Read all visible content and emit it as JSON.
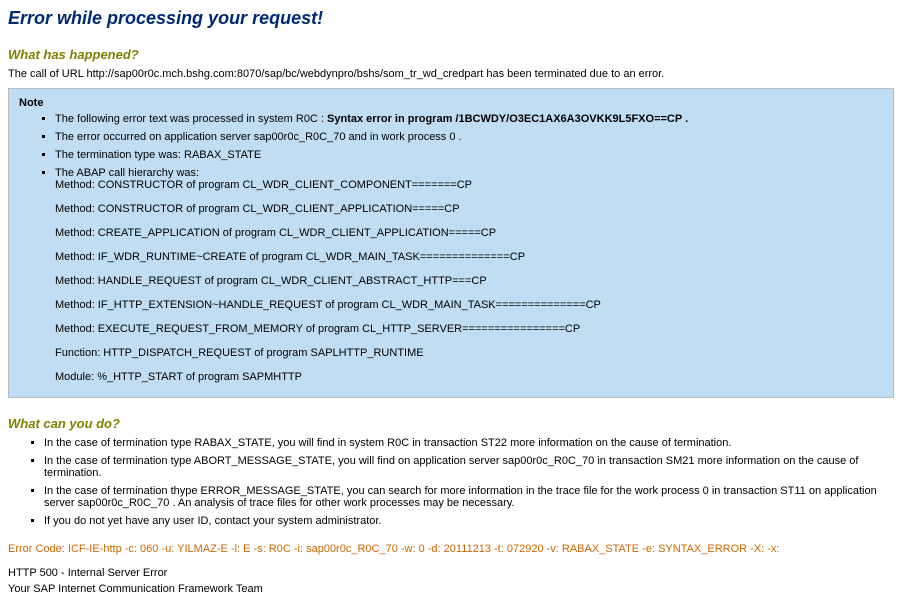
{
  "title": "Error while processing your request!",
  "section1": {
    "heading": "What has happened?",
    "text": "The call of URL http://sap00r0c.mch.bshg.com:8070/sap/bc/webdynpro/bshs/som_tr_wd_credpart has been terminated due to an error."
  },
  "note": {
    "title": "Note",
    "items": [
      {
        "prefix": "The following error text was processed in system R0C : ",
        "bold": "Syntax error in program /1BCWDY/O3EC1AX6A3OVKK9L5FXO==CP ."
      },
      {
        "text": "The error occurred on application server sap00r0c_R0C_70 and in work process 0 ."
      },
      {
        "text": "The termination type was: RABAX_STATE"
      },
      {
        "text": "The ABAP call hierarchy was:",
        "hierarchy": [
          "Method: CONSTRUCTOR of program CL_WDR_CLIENT_COMPONENT=======CP",
          "Method: CONSTRUCTOR of program CL_WDR_CLIENT_APPLICATION=====CP",
          "Method: CREATE_APPLICATION of program CL_WDR_CLIENT_APPLICATION=====CP",
          "Method: IF_WDR_RUNTIME~CREATE of program CL_WDR_MAIN_TASK==============CP",
          "Method: HANDLE_REQUEST of program CL_WDR_CLIENT_ABSTRACT_HTTP===CP",
          "Method: IF_HTTP_EXTENSION~HANDLE_REQUEST of program CL_WDR_MAIN_TASK==============CP",
          "Method: EXECUTE_REQUEST_FROM_MEMORY of program CL_HTTP_SERVER================CP",
          "Function: HTTP_DISPATCH_REQUEST of program SAPLHTTP_RUNTIME",
          "Module: %_HTTP_START of program SAPMHTTP"
        ]
      }
    ]
  },
  "section2": {
    "heading": "What can you do?",
    "items": [
      "In the case of termination type RABAX_STATE, you will find in system R0C in transaction ST22 more information on the cause of termination.",
      "In the case of termination type ABORT_MESSAGE_STATE, you will find on application server sap00r0c_R0C_70 in transaction SM21 more information on the cause of termination.",
      "In the case of termination thype ERROR_MESSAGE_STATE, you can search for more information in the trace file for the work process 0 in transaction ST11 on application server sap00r0c_R0C_70 . An analysis of trace files for other work processes may be necessary.",
      "If you do not yet have any user ID, contact your system administrator."
    ]
  },
  "error_code": "Error Code: ICF-IE-http -c: 060 -u: YILMAZ-E -l: E -s: R0C -i: sap00r0c_R0C_70 -w: 0 -d: 20111213 -t: 072920 -v: RABAX_STATE -e: SYNTAX_ERROR -X: -x:",
  "footer": {
    "line1": "HTTP 500 - Internal Server Error",
    "line2": "Your SAP Internet Communication Framework Team"
  }
}
